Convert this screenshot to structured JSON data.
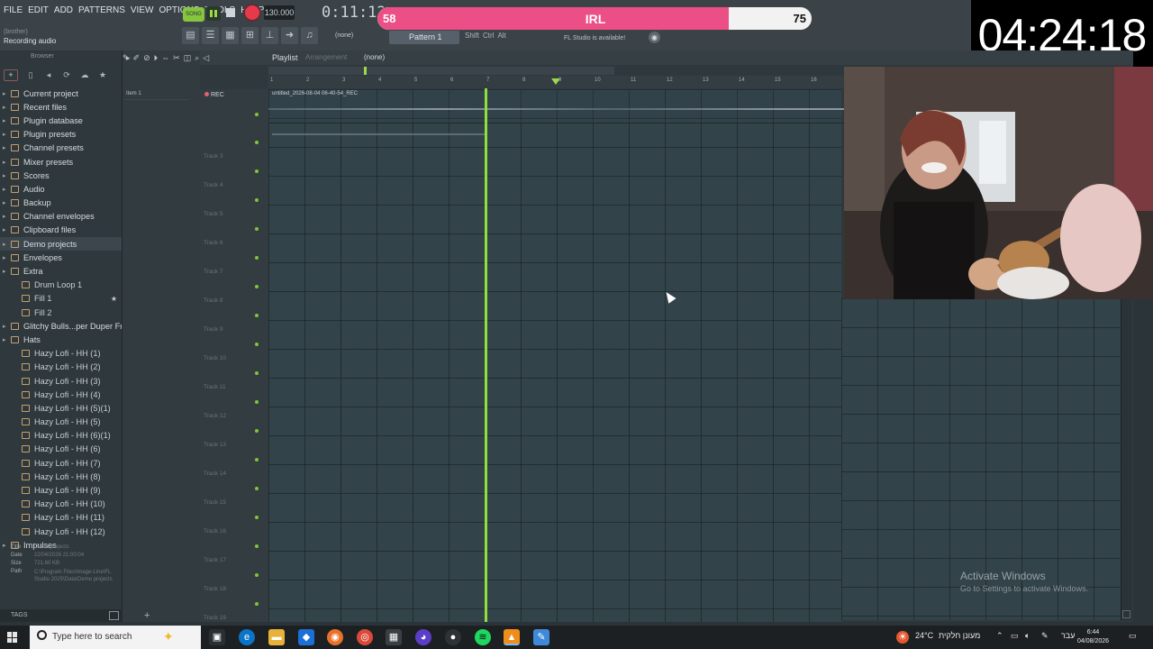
{
  "menu": [
    "FILE",
    "EDIT",
    "ADD",
    "PATTERNS",
    "VIEW",
    "OPTIONS",
    "TOOLS",
    "HELP"
  ],
  "transport": {
    "song_label": "SONG",
    "tempo": "130.000",
    "time": "0:11:12"
  },
  "hint": "(brother)",
  "status": "Recording audio",
  "toolbar": {
    "none_label": "(none)",
    "pattern": "Pattern 1",
    "mod_keys": [
      "Shift",
      "Ctrl",
      "Alt"
    ],
    "update_msg": "FL Studio is available!"
  },
  "goal": {
    "start": "58",
    "title": "IRL",
    "end": "75",
    "progress": 0.81,
    "fill_color": "#ec4e86"
  },
  "stream_clock": "04:24:18",
  "browser": {
    "title": "Browser",
    "items": [
      {
        "label": "Current project",
        "level": 0
      },
      {
        "label": "Recent files",
        "level": 0
      },
      {
        "label": "Plugin database",
        "level": 0
      },
      {
        "label": "Plugin presets",
        "level": 0
      },
      {
        "label": "Channel presets",
        "level": 0
      },
      {
        "label": "Mixer presets",
        "level": 0
      },
      {
        "label": "Scores",
        "level": 0
      },
      {
        "label": "Audio",
        "level": 0
      },
      {
        "label": "Backup",
        "level": 0
      },
      {
        "label": "Channel envelopes",
        "level": 0
      },
      {
        "label": "Clipboard files",
        "level": 0
      },
      {
        "label": "Demo projects",
        "level": 0,
        "highlight": true
      },
      {
        "label": "Envelopes",
        "level": 0
      },
      {
        "label": "Extra",
        "level": 0
      },
      {
        "label": "Drum Loop 1",
        "level": 1
      },
      {
        "label": "Fill 1",
        "level": 1,
        "star": true
      },
      {
        "label": "Fill 2",
        "level": 1
      },
      {
        "label": "Glitchy Bulls...per Duper Free",
        "level": 0
      },
      {
        "label": "Hats",
        "level": 0
      },
      {
        "label": "Hazy Lofi - HH (1)",
        "level": 1
      },
      {
        "label": "Hazy Lofi - HH (2)",
        "level": 1
      },
      {
        "label": "Hazy Lofi - HH (3)",
        "level": 1
      },
      {
        "label": "Hazy Lofi - HH (4)",
        "level": 1
      },
      {
        "label": "Hazy Lofi - HH (5)(1)",
        "level": 1
      },
      {
        "label": "Hazy Lofi - HH (5)",
        "level": 1
      },
      {
        "label": "Hazy Lofi - HH (6)(1)",
        "level": 1
      },
      {
        "label": "Hazy Lofi - HH (6)",
        "level": 1
      },
      {
        "label": "Hazy Lofi - HH (7)",
        "level": 1
      },
      {
        "label": "Hazy Lofi - HH (8)",
        "level": 1
      },
      {
        "label": "Hazy Lofi - HH (9)",
        "level": 1
      },
      {
        "label": "Hazy Lofi - HH (10)",
        "level": 1
      },
      {
        "label": "Hazy Lofi - HH (11)",
        "level": 1
      },
      {
        "label": "Hazy Lofi - HH (12)",
        "level": 1
      },
      {
        "label": "Impulses",
        "level": 0
      }
    ],
    "info": {
      "title_k": "Title",
      "title_v": "Demo projects",
      "date_k": "Date",
      "date_v": "22/04/2026 21:00:04",
      "size_k": "Size",
      "size_v": "721.60 KB",
      "path_k": "Path",
      "path_v": "C:\\Program Files\\Image-Line\\FL Studio 2025\\Data\\Demo projects"
    },
    "tags": "TAGS"
  },
  "channel": {
    "item": "Item 1"
  },
  "playlist": {
    "title": "Playlist",
    "arrangement": "Arrangement",
    "pattern": "(none)",
    "ruler": [
      "1",
      "2",
      "3",
      "4",
      "5",
      "6",
      "7",
      "8",
      "9",
      "10",
      "11",
      "12",
      "13",
      "14",
      "15",
      "16"
    ],
    "rec_track": "REC",
    "clip_name": "untitled_2026-08-04 06-40-54_REC",
    "tracks": [
      "Track 3",
      "Track 4",
      "Track 5",
      "Track 6",
      "Track 7",
      "Track 8",
      "Track 9",
      "Track 10",
      "Track 11",
      "Track 12",
      "Track 13",
      "Track 14",
      "Track 15",
      "Track 16",
      "Track 17",
      "Track 18",
      "Track 19"
    ]
  },
  "watermark": {
    "line1": "Activate Windows",
    "line2": "Go to Settings to activate Windows."
  },
  "taskbar": {
    "search": "Type here to search",
    "weather": "24°C",
    "weather_text": "מעונן חלקית",
    "lang": "עבר",
    "time": "6:44",
    "date": "04/08/2026"
  }
}
